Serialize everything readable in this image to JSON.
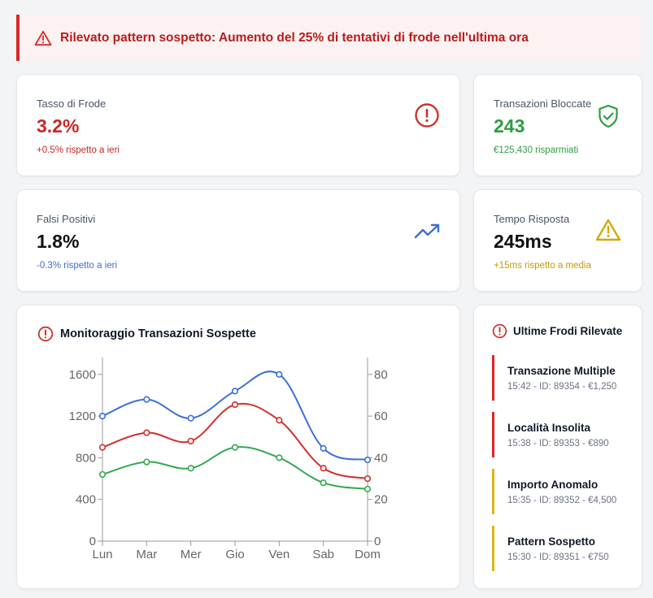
{
  "alert": {
    "icon": "warning-triangle-icon",
    "color": "#dc2626",
    "text": "Rilevato pattern sospetto: Aumento del 25% di tentativi di frode nell'ultima ora"
  },
  "stats": {
    "fraud_rate": {
      "label": "Tasso di Frode",
      "value": "3.2%",
      "sub": "+0.5% rispetto a ieri",
      "icon": "alert-circle-icon",
      "color": "#c62828"
    },
    "blocked": {
      "label": "Transazioni Bloccate",
      "value": "243",
      "sub": "€125,430 risparmiati",
      "icon": "shield-check-icon",
      "color": "#2e9e3f"
    },
    "false_positives": {
      "label": "Falsi Positivi",
      "value": "1.8%",
      "sub": "-0.3% rispetto a ieri",
      "icon": "trending-up-icon",
      "color": "#3f6fce"
    },
    "response_time": {
      "label": "Tempo Risposta",
      "value": "245ms",
      "sub": "+15ms rispetto a media",
      "icon": "warning-triangle-icon",
      "color": "#c49a06"
    }
  },
  "monitor": {
    "title": "Monitoraggio Transazioni Sospette",
    "icon": "alert-circle-icon"
  },
  "chart_data": {
    "type": "line",
    "categories": [
      "Lun",
      "Mar",
      "Mer",
      "Gio",
      "Ven",
      "Sab",
      "Dom"
    ],
    "y_left": {
      "ticks": [
        "0",
        "400",
        "800",
        "1200",
        "1600"
      ],
      "range": [
        0,
        1700
      ]
    },
    "y_right": {
      "ticks": [
        "0",
        "20",
        "40",
        "60",
        "80"
      ],
      "range": [
        0,
        85
      ]
    },
    "grid": false,
    "series": [
      {
        "color": "#3b6fd9",
        "axis": "left",
        "values": [
          1200,
          1360,
          1180,
          1440,
          1600,
          890,
          780
        ]
      },
      {
        "color": "#d0312d",
        "axis": "left",
        "values": [
          900,
          1040,
          960,
          1310,
          1160,
          700,
          600
        ]
      },
      {
        "color": "#34a853",
        "axis": "left",
        "values": [
          640,
          760,
          700,
          900,
          800,
          560,
          500
        ]
      }
    ]
  },
  "recent": {
    "title": "Ultime Frodi Rilevate",
    "icon": "alert-circle-icon",
    "items": [
      {
        "title": "Transazione Multiple",
        "meta": "15:42 - ID: 89354 - €1,250",
        "level": "high"
      },
      {
        "title": "Località Insolita",
        "meta": "15:38 - ID: 89353 - €890",
        "level": "high"
      },
      {
        "title": "Importo Anomalo",
        "meta": "15:35 - ID: 89352 - €4,500",
        "level": "medium"
      },
      {
        "title": "Pattern Sospetto",
        "meta": "15:30 - ID: 89351 - €750",
        "level": "medium"
      }
    ]
  }
}
